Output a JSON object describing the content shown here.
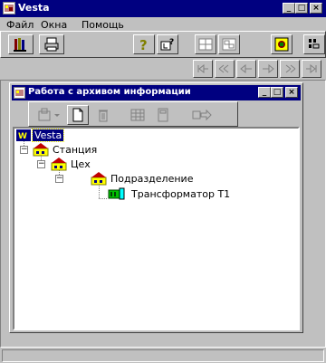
{
  "app": {
    "title": "Vesta",
    "icon": "vesta-app-icon"
  },
  "menu": [
    {
      "label": "Файл"
    },
    {
      "label": "Окна"
    },
    {
      "label": "Помощь"
    }
  ],
  "window_buttons": {
    "minimize": "_",
    "maximize": "□",
    "close": "×"
  },
  "toolbar": {
    "icons": [
      "library-icon",
      "print-icon",
      "help-icon",
      "help-cursor-icon",
      "grid-icon",
      "image-icon",
      "refresh-icon",
      "chart-icon"
    ],
    "nav_icons": [
      "first-record-icon",
      "prev-page-icon",
      "prev-record-icon",
      "next-record-icon",
      "next-page-icon",
      "last-record-icon"
    ]
  },
  "archive_window": {
    "title": "Работа с архивом информации",
    "toolbar_icons": [
      "add-dropdown-icon",
      "new-document-icon",
      "delete-icon",
      "table-icon",
      "calculator-icon",
      "transfer-icon"
    ]
  },
  "tree": [
    {
      "label": "Vesta",
      "level": 0,
      "icon": "vesta-root-icon",
      "selected": true
    },
    {
      "label": "Станция",
      "level": 1,
      "icon": "station-icon",
      "expander": "-"
    },
    {
      "label": "Цех",
      "level": 2,
      "icon": "workshop-icon",
      "expander": "-"
    },
    {
      "label": "Подразделение",
      "level": 3,
      "icon": "department-icon",
      "expander": "-"
    },
    {
      "label": "Трансформатор Т1",
      "level": 4,
      "icon": "transformer-icon"
    }
  ],
  "colors": {
    "titlebar": "#000080",
    "face": "#c0c0c0",
    "selection": "#000080"
  }
}
